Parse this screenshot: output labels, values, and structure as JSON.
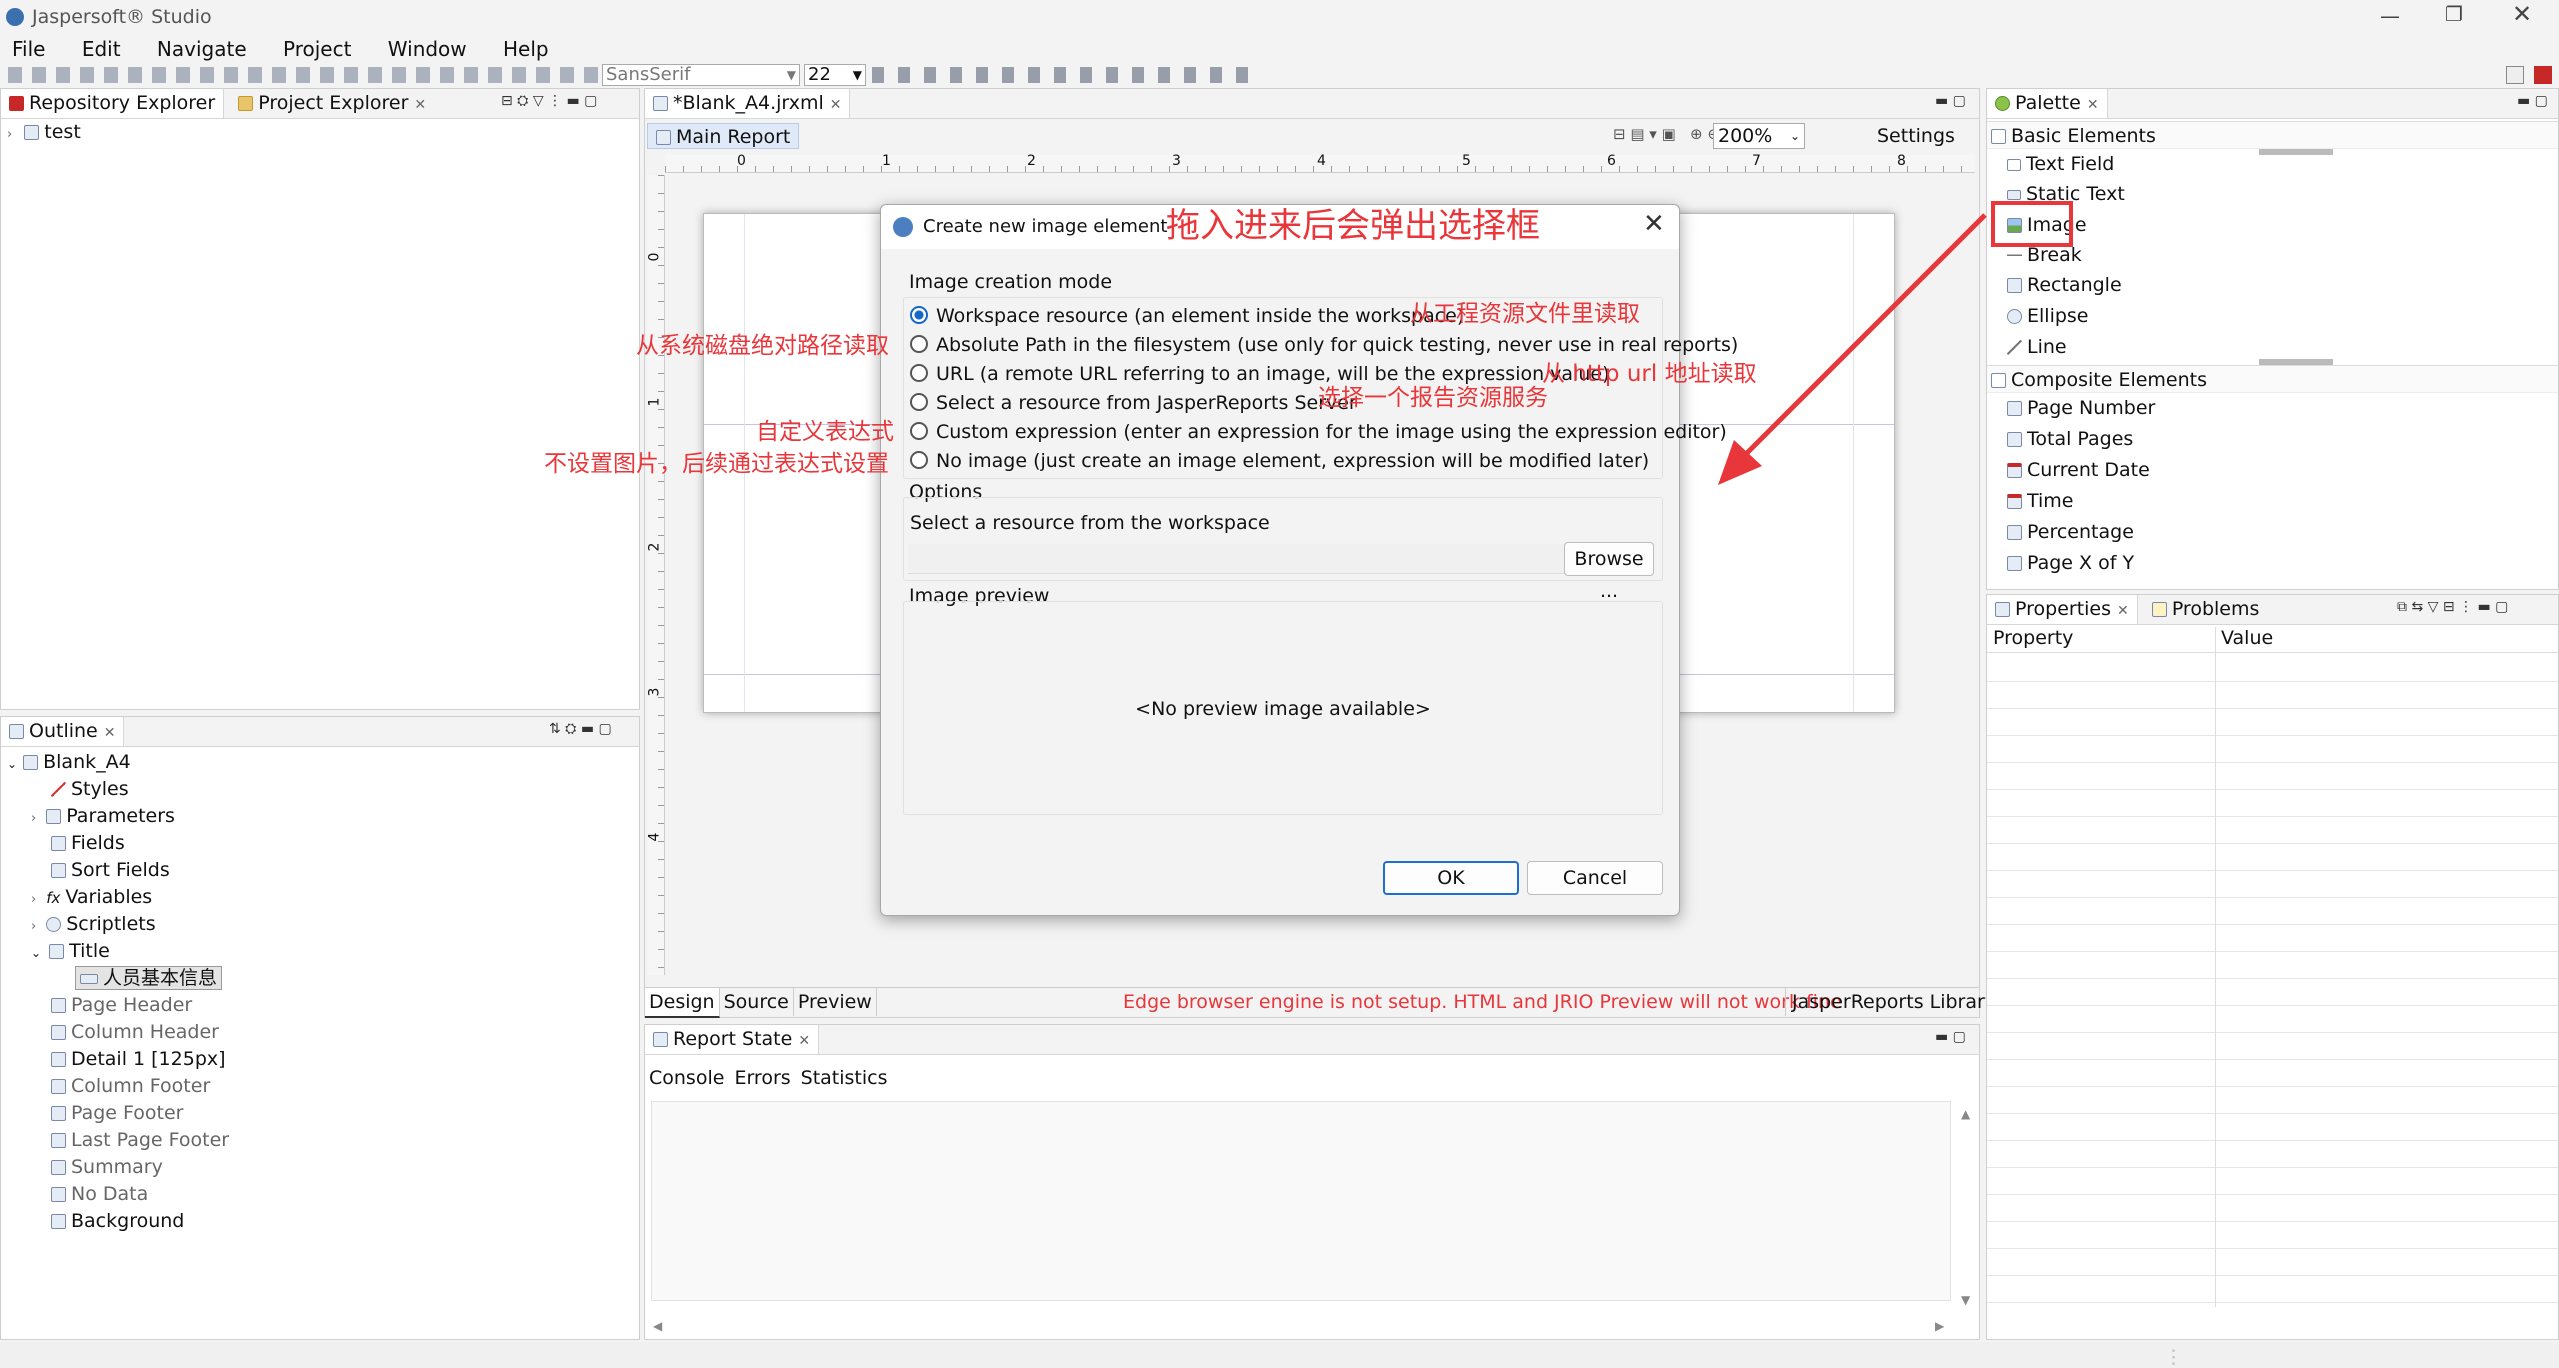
{
  "app": {
    "title": "Jaspersoft® Studio"
  },
  "menu": [
    "File",
    "Edit",
    "Navigate",
    "Project",
    "Window",
    "Help"
  ],
  "toolbar": {
    "font_name": "SansSerif",
    "font_size": "22"
  },
  "left_top": {
    "tabs": [
      "Repository Explorer",
      "Project Explorer"
    ],
    "tree": [
      "test"
    ]
  },
  "outline": {
    "tab": "Outline",
    "root": "Blank_A4",
    "items": [
      "Styles",
      "Parameters",
      "Fields",
      "Sort Fields",
      "Variables",
      "Scriptlets",
      "Title",
      "人员基本信息",
      "Page Header",
      "Column Header",
      "Detail 1 [125px]",
      "Column Footer",
      "Page Footer",
      "Last Page Footer",
      "Summary",
      "No Data",
      "Background"
    ]
  },
  "editor": {
    "file_tab": "*Blank_A4.jrxml",
    "report_tab": "Main Report",
    "zoom": "200%",
    "settings": "Settings",
    "ruler_marks": [
      "0",
      "1",
      "2",
      "3",
      "4",
      "5",
      "6",
      "7",
      "8"
    ],
    "vruler_marks": [
      "0",
      "1",
      "2",
      "3",
      "4"
    ],
    "bottom_tabs": [
      "Design",
      "Source",
      "Preview"
    ],
    "warning": "Edge browser engine is not setup. HTML and JRIO Preview will not work fine",
    "library": "JasperReports Library"
  },
  "report_state": {
    "tab": "Report State",
    "subtabs": [
      "Console",
      "Errors",
      "Statistics"
    ]
  },
  "palette": {
    "tab": "Palette",
    "basic_header": "Basic Elements",
    "basic": [
      "Text Field",
      "Static Text",
      "Image",
      "Break",
      "Rectangle",
      "Ellipse",
      "Line"
    ],
    "composite_header": "Composite Elements",
    "composite": [
      "Page Number",
      "Total Pages",
      "Current Date",
      "Time",
      "Percentage",
      "Page X of Y"
    ]
  },
  "properties": {
    "tabs": [
      "Properties",
      "Problems"
    ],
    "col_property": "Property",
    "col_value": "Value"
  },
  "dialog": {
    "title": "Create new image element",
    "mode_label": "Image creation mode",
    "options": [
      "Workspace resource (an element inside the workspace)",
      "Absolute Path in the filesystem (use only for quick testing, never use in real reports)",
      "URL (a remote URL referring to an image, will be the expression value)",
      "Select a resource from JasperReports Server",
      "Custom expression (enter an expression for the image using the expression editor)",
      "No image (just create an image element, expression will be modified later)"
    ],
    "selected_index": 0,
    "options_label": "Options",
    "options_desc": "Select a resource from the workspace",
    "browse": "Browse ...",
    "preview_label": "Image preview",
    "no_preview": "<No preview image available>",
    "ok": "OK",
    "cancel": "Cancel"
  },
  "annotations": {
    "title_note": "拖入进来后会弹出选择框",
    "workspace": "从工程资源文件里读取",
    "absolute": "从系统磁盘绝对路径读取",
    "url": "从 http url 地址读取",
    "server": "选择一个报告资源服务",
    "custom": "自定义表达式",
    "none": "不设置图片，后续通过表达式设置"
  },
  "colors": {
    "annotation": "#e8363a",
    "accent": "#1467c7"
  }
}
